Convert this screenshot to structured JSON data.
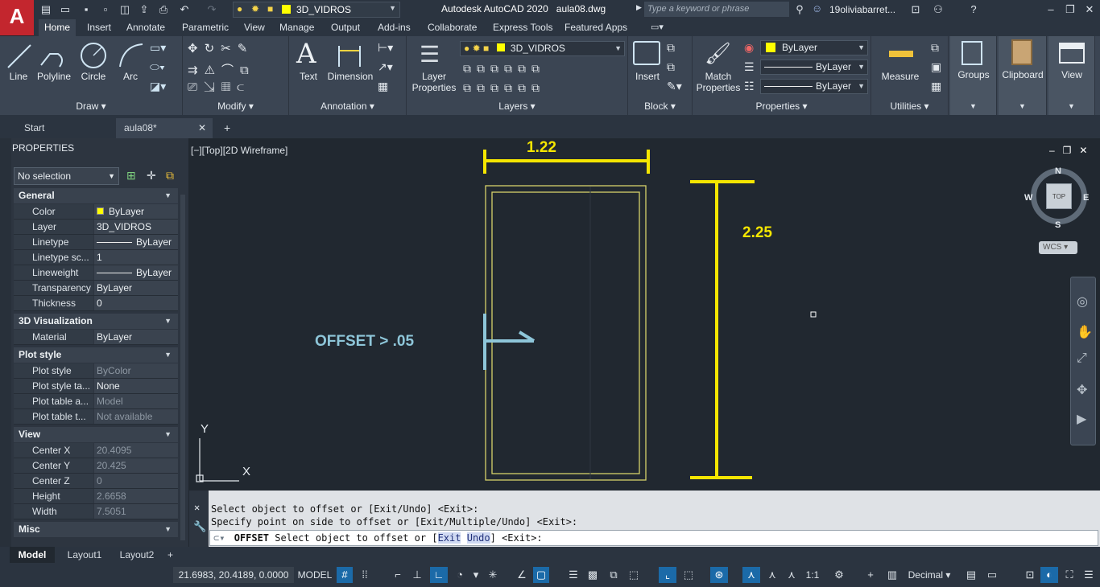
{
  "app": {
    "logo_letter": "A",
    "title": "Autodesk AutoCAD 2020",
    "file": "aula08.dwg",
    "search_placeholder": "Type a keyword or phrase",
    "user": "19oliviabarret...",
    "quick_layer": "3D_VIDROS"
  },
  "ribbon_tabs": [
    "Home",
    "Insert",
    "Annotate",
    "Parametric",
    "View",
    "Manage",
    "Output",
    "Add-ins",
    "Collaborate",
    "Express Tools",
    "Featured Apps"
  ],
  "ribbon": {
    "draw": {
      "line": "Line",
      "polyline": "Polyline",
      "circle": "Circle",
      "arc": "Arc",
      "title": "Draw"
    },
    "modify": {
      "title": "Modify"
    },
    "annotation": {
      "text": "Text",
      "dimension": "Dimension",
      "title": "Annotation"
    },
    "layers": {
      "layer_props_line1": "Layer",
      "layer_props_line2": "Properties",
      "current_layer": "3D_VIDROS",
      "title": "Layers"
    },
    "block": {
      "insert": "Insert",
      "title": "Block"
    },
    "properties": {
      "match_line1": "Match",
      "match_line2": "Properties",
      "color": "ByLayer",
      "linetype": "ByLayer",
      "lineweight": "ByLayer",
      "title": "Properties"
    },
    "utilities": {
      "measure": "Measure",
      "title": "Utilities"
    },
    "groups": "Groups",
    "clipboard": "Clipboard",
    "view": "View"
  },
  "file_tabs": {
    "start": "Start",
    "current": "aula08*"
  },
  "properties_palette": {
    "title": "PROPERTIES",
    "selection": "No selection",
    "sections": {
      "general": "General",
      "viz3d": "3D Visualization",
      "plot": "Plot style",
      "view": "View",
      "misc": "Misc"
    },
    "general": [
      {
        "k": "Color",
        "v": "ByLayer"
      },
      {
        "k": "Layer",
        "v": "3D_VIDROS"
      },
      {
        "k": "Linetype",
        "v": "ByLayer"
      },
      {
        "k": "Linetype sc...",
        "v": "1"
      },
      {
        "k": "Lineweight",
        "v": "ByLayer"
      },
      {
        "k": "Transparency",
        "v": "ByLayer"
      },
      {
        "k": "Thickness",
        "v": "0"
      }
    ],
    "viz3d": [
      {
        "k": "Material",
        "v": "ByLayer"
      }
    ],
    "plot": [
      {
        "k": "Plot style",
        "v": "ByColor"
      },
      {
        "k": "Plot style ta...",
        "v": "None"
      },
      {
        "k": "Plot table a...",
        "v": "Model"
      },
      {
        "k": "Plot table t...",
        "v": "Not available"
      }
    ],
    "view": [
      {
        "k": "Center X",
        "v": "20.4095"
      },
      {
        "k": "Center Y",
        "v": "20.425"
      },
      {
        "k": "Center Z",
        "v": "0"
      },
      {
        "k": "Height",
        "v": "2.6658"
      },
      {
        "k": "Width",
        "v": "7.5051"
      }
    ]
  },
  "viewport": {
    "label": "[−][Top][2D Wireframe]",
    "dim_width": "1.22",
    "dim_height": "2.25",
    "annotation": "OFFSET > .05",
    "ucs_x": "X",
    "ucs_y": "Y"
  },
  "viewcube": {
    "n": "N",
    "s": "S",
    "e": "E",
    "w": "W",
    "face": "TOP",
    "wcs": "WCS"
  },
  "command": {
    "line1": "Select object to offset or [Exit/Undo] <Exit>:",
    "line2": "Specify point on side to offset or [Exit/Multiple/Undo] <Exit>:",
    "prompt_cmd": "OFFSET",
    "prompt_text": "Select object to offset or [",
    "opt_exit": "Exit",
    "opt_undo": "Undo",
    "prompt_tail": "] <Exit>:"
  },
  "layout_tabs": [
    "Model",
    "Layout1",
    "Layout2"
  ],
  "status": {
    "coords": "21.6983, 20.4189, 0.0000",
    "model": "MODEL",
    "scale": "1:1",
    "units": "Decimal"
  },
  "colors": {
    "accent": "#1b6aa8",
    "dimension": "#f5e600",
    "rectangle": "#d6d26a",
    "annotation": "#8ec6d9",
    "logo": "#c3262e"
  }
}
